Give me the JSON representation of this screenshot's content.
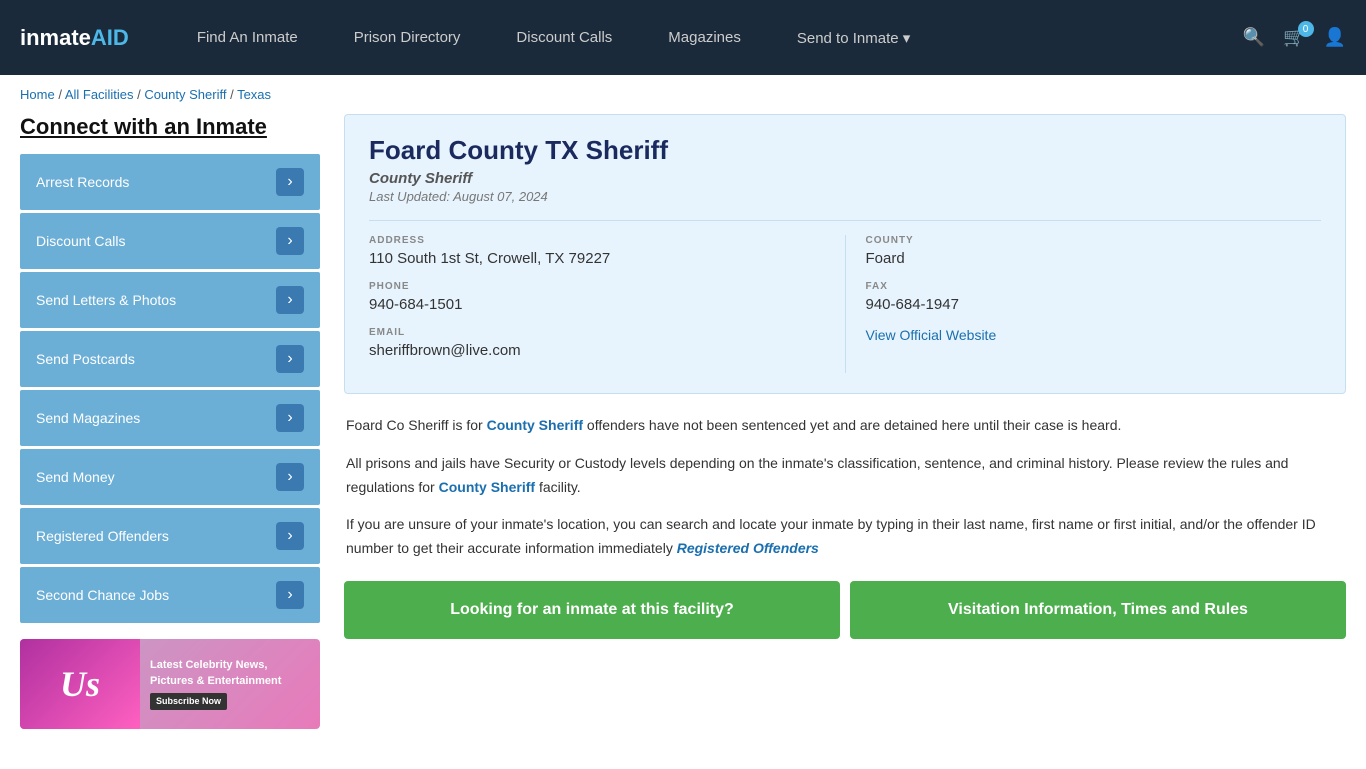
{
  "navbar": {
    "logo": "inmateAID",
    "logo_color": "AID",
    "links": [
      {
        "label": "Find An Inmate",
        "id": "find-inmate"
      },
      {
        "label": "Prison Directory",
        "id": "prison-directory"
      },
      {
        "label": "Discount Calls",
        "id": "discount-calls"
      },
      {
        "label": "Magazines",
        "id": "magazines"
      },
      {
        "label": "Send to Inmate ▾",
        "id": "send-to-inmate"
      }
    ],
    "cart_count": "0"
  },
  "breadcrumb": {
    "home": "Home",
    "all_facilities": "All Facilities",
    "county_sheriff": "County Sheriff",
    "texas": "Texas"
  },
  "sidebar": {
    "title": "Connect with an Inmate",
    "items": [
      {
        "label": "Arrest Records"
      },
      {
        "label": "Discount Calls"
      },
      {
        "label": "Send Letters & Photos"
      },
      {
        "label": "Send Postcards"
      },
      {
        "label": "Send Magazines"
      },
      {
        "label": "Send Money"
      },
      {
        "label": "Registered Offenders"
      },
      {
        "label": "Second Chance Jobs"
      }
    ]
  },
  "ad": {
    "text": "Latest Celebrity News, Pictures & Entertainment",
    "btn_label": "Subscribe Now"
  },
  "facility": {
    "name": "Foard County TX Sheriff",
    "type": "County Sheriff",
    "last_updated": "Last Updated: August 07, 2024",
    "address_label": "ADDRESS",
    "address": "110 South 1st St, Crowell, TX 79227",
    "county_label": "COUNTY",
    "county": "Foard",
    "phone_label": "PHONE",
    "phone": "940-684-1501",
    "fax_label": "FAX",
    "fax": "940-684-1947",
    "email_label": "EMAIL",
    "email": "sheriffbrown@live.com",
    "website_label": "View Official Website"
  },
  "description": {
    "p1_before": "Foard Co Sheriff is for ",
    "p1_link": "County Sheriff",
    "p1_after": " offenders have not been sentenced yet and are detained here until their case is heard.",
    "p2_before": "All prisons and jails have Security or Custody levels depending on the inmate's classification, sentence, and criminal history. Please review the rules and regulations for ",
    "p2_link": "County Sheriff",
    "p2_after": " facility.",
    "p3_before": "If you are unsure of your inmate's location, you can search and locate your inmate by typing in their last name, first name or first initial, and/or the offender ID number to get their accurate information immediately ",
    "p3_link": "Registered Offenders"
  },
  "buttons": {
    "find_inmate": "Looking for an inmate at this facility?",
    "visitation": "Visitation Information, Times and Rules"
  }
}
